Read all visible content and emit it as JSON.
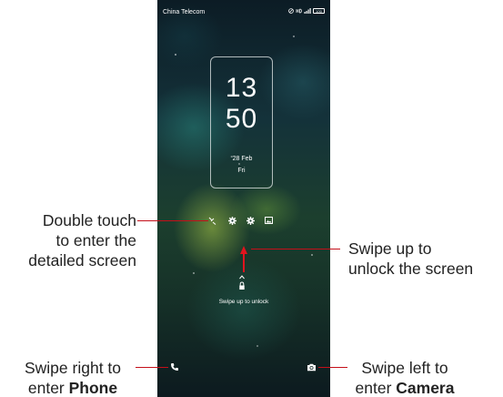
{
  "status_bar": {
    "carrier": "China Telecom",
    "battery": "100"
  },
  "clock": {
    "hour": "13",
    "minute": "50",
    "date": "28 Feb",
    "day": "Fri"
  },
  "shortcuts": [
    "missed-calls-icon",
    "settings-icon",
    "settings-icon",
    "gallery-icon"
  ],
  "unlock_hint": "Swipe up to unlock",
  "annotations": {
    "double_touch": [
      "Double touch",
      "to enter the",
      "detailed screen"
    ],
    "swipe_up": [
      "Swipe up to",
      "unlock the screen"
    ],
    "swipe_right_line1": "Swipe right to",
    "swipe_right_line2_prefix": "enter ",
    "swipe_right_line2_bold": "Phone",
    "swipe_left_line1": "Swipe left to",
    "swipe_left_line2_prefix": "enter ",
    "swipe_left_line2_bold": "Camera"
  },
  "colors": {
    "annotation_line": "#c40f19",
    "arrow": "#e0141e"
  }
}
